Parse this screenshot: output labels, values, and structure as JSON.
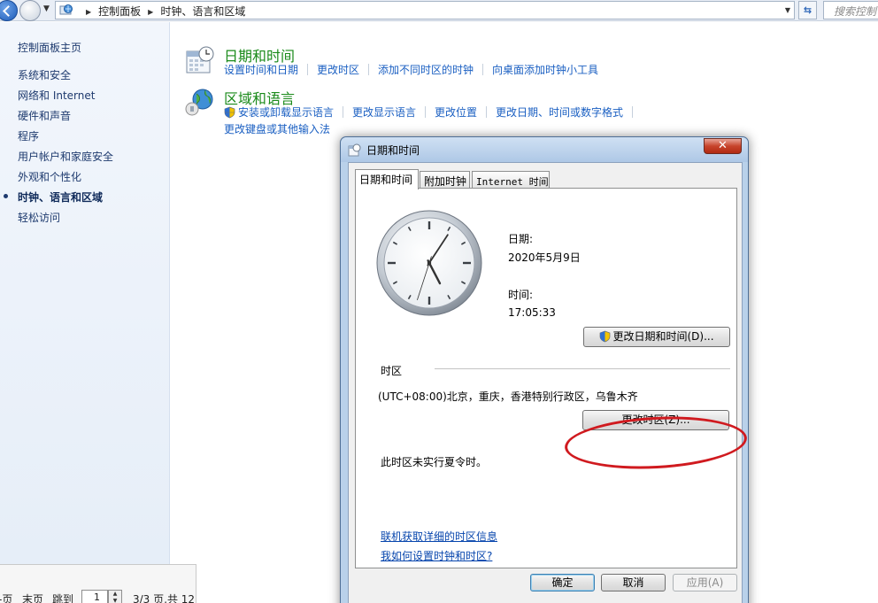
{
  "address_bar": {
    "crumbs": [
      "控制面板",
      "时钟、语言和区域"
    ],
    "search_placeholder": "搜索控制"
  },
  "sidebar": {
    "home": "控制面板主页",
    "items": [
      {
        "label": "系统和安全",
        "active": false
      },
      {
        "label": "网络和 Internet",
        "active": false
      },
      {
        "label": "硬件和声音",
        "active": false
      },
      {
        "label": "程序",
        "active": false
      },
      {
        "label": "用户帐户和家庭安全",
        "active": false
      },
      {
        "label": "外观和个性化",
        "active": false
      },
      {
        "label": "时钟、语言和区域",
        "active": true
      },
      {
        "label": "轻松访问",
        "active": false
      }
    ]
  },
  "categories": [
    {
      "title": "日期和时间",
      "icon": "calendar-clock-icon",
      "links": [
        "设置时间和日期",
        "更改时区",
        "添加不同时区的时钟",
        "向桌面添加时钟小工具"
      ]
    },
    {
      "title": "区域和语言",
      "icon": "globe-icon",
      "links": [
        "安装或卸载显示语言",
        "更改显示语言",
        "更改位置",
        "更改日期、时间或数字格式"
      ],
      "links2": [
        "更改键盘或其他输入法"
      ]
    }
  ],
  "pager": {
    "prev": "-页",
    "last": "末页",
    "jump": "跳到",
    "page_value": "1",
    "summary": "3/3 页,共 12"
  },
  "dialog": {
    "title": "日期和时间",
    "close": "✕",
    "tabs": [
      "日期和时间",
      "附加时钟",
      "Internet 时间"
    ],
    "date_label": "日期:",
    "date_value": "2020年5月9日",
    "time_label": "时间:",
    "time_value": "17:05:33",
    "change_datetime_button": "更改日期和时间(D)...",
    "timezone_label": "时区",
    "timezone_value": "(UTC+08:00)北京，重庆，香港特别行政区，乌鲁木齐",
    "change_timezone_button": "更改时区(Z)...",
    "dst_note": "此时区未实行夏令时。",
    "link_tz_info": "联机获取详细的时区信息",
    "link_how_to": "我如何设置时钟和时区?",
    "ok": "确定",
    "cancel": "取消",
    "apply": "应用(A)",
    "clock": {
      "hour": 5,
      "minute": 5,
      "second": 33
    }
  }
}
